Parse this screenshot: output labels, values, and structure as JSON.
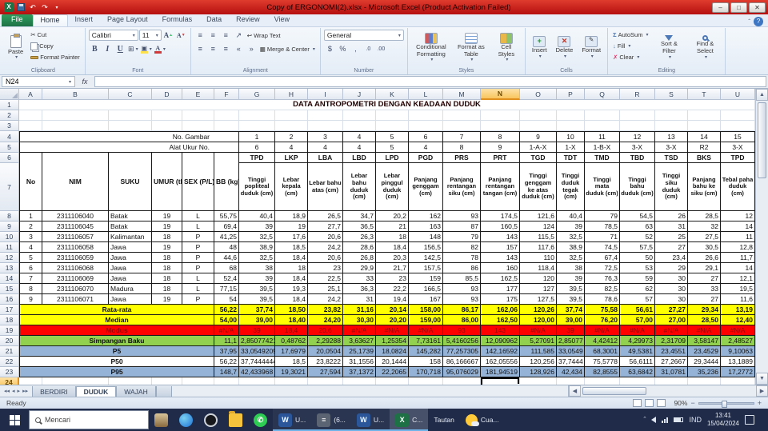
{
  "titlebar": {
    "title": "Copy of ERGONOMI(2).xlsx  -  Microsoft Excel (Product Activation Failed)"
  },
  "ribbon": {
    "file_tab": "File",
    "tabs": [
      "Home",
      "Insert",
      "Page Layout",
      "Formulas",
      "Data",
      "Review",
      "View"
    ],
    "active_tab": "Home",
    "clipboard": {
      "label": "Clipboard",
      "paste": "Paste",
      "cut": "Cut",
      "copy": "Copy",
      "format_painter": "Format Painter"
    },
    "font": {
      "label": "Font",
      "family": "Calibri",
      "size": "11",
      "bold": "B",
      "italic": "I",
      "underline": "U",
      "grow": "A",
      "shrink": "A"
    },
    "alignment": {
      "label": "Alignment",
      "wrap_text": "Wrap Text",
      "merge_center": "Merge & Center"
    },
    "number": {
      "label": "Number",
      "format": "General",
      "buttons": [
        "$",
        "%",
        ",",
        ".0",
        ".00"
      ]
    },
    "styles": {
      "label": "Styles",
      "conditional": "Conditional Formatting",
      "format_table": "Format as Table",
      "cell_styles": "Cell Styles"
    },
    "cells": {
      "label": "Cells",
      "insert": "Insert",
      "delete": "Delete",
      "format": "Format"
    },
    "editing": {
      "label": "Editing",
      "autosum": "AutoSum",
      "fill": "Fill",
      "clear": "Clear",
      "sort_filter": "Sort & Filter",
      "find_select": "Find & Select"
    }
  },
  "formula_bar": {
    "name_box": "N24",
    "fx": "fx",
    "content": ""
  },
  "sheet": {
    "selected_cell": "N24",
    "selected_col": "N",
    "selected_row": 24,
    "col_letters": [
      "A",
      "B",
      "C",
      "D",
      "E",
      "F",
      "G",
      "H",
      "I",
      "J",
      "K",
      "L",
      "M",
      "N",
      "O",
      "P",
      "Q",
      "R",
      "S",
      "T",
      "U"
    ],
    "title": "DATA ANTROPOMETRI DENGAN KEADAAN DUDUK",
    "gambar_label": "No. Gambar",
    "gambar_values": [
      "1",
      "2",
      "3",
      "4",
      "5",
      "6",
      "7",
      "8",
      "9",
      "10",
      "11",
      "12",
      "13",
      "14",
      "15"
    ],
    "alat_label": "Alat Ukur No.",
    "alat_values": [
      "6",
      "4",
      "4",
      "4",
      "5",
      "4",
      "8",
      "9",
      "1-A-X",
      "1-X",
      "1-B-X",
      "3-X",
      "3-X",
      "R2",
      "3-X"
    ],
    "left_headers": [
      "No",
      "NIM",
      "SUKU",
      "UMUR (th)",
      "SEX (P/L)",
      "BB (kg)"
    ],
    "codes": [
      "TPD",
      "LKP",
      "LBA",
      "LBD",
      "LPD",
      "PGD",
      "PRS",
      "PRT",
      "TGD",
      "TDT",
      "TMD",
      "TBD",
      "TSD",
      "BKS",
      "TPD"
    ],
    "measure_headers": [
      "Tinggi popliteal duduk (cm)",
      "Lebar kepala (cm)",
      "Lebar bahu atas (cm)",
      "Lebar bahu duduk (cm)",
      "Lebar pinggul duduk (cm)",
      "Panjang genggam (cm)",
      "Panjang rentangan siku (cm)",
      "Panjang rentangan tangan (cm)",
      "Tinggi genggam ke atas duduk (cm)",
      "Tinggi duduk tegak (cm)",
      "Tinggi mata duduk (cm)",
      "Tinggi bahu duduk (cm)",
      "Tinggi siku duduk (cm)",
      "Panjang bahu ke siku (cm)",
      "Tebal paha duduk (cm)"
    ],
    "data_rows": [
      [
        "1",
        "2311106040",
        "Batak",
        "19",
        "L",
        "55,75",
        "40,4",
        "18,9",
        "26,5",
        "34,7",
        "20,2",
        "162",
        "93",
        "174,5",
        "121,6",
        "40,4",
        "79",
        "54,5",
        "26",
        "28,5",
        "12"
      ],
      [
        "2",
        "2311106045",
        "Batak",
        "19",
        "L",
        "69,4",
        "39",
        "19",
        "27,7",
        "36,5",
        "21",
        "163",
        "87",
        "160,5",
        "124",
        "39",
        "78,5",
        "63",
        "31",
        "32",
        "14"
      ],
      [
        "3",
        "2311106057",
        "Kalimantan",
        "18",
        "P",
        "41,25",
        "32,5",
        "17,6",
        "20,6",
        "26,3",
        "18",
        "148",
        "79",
        "143",
        "115,5",
        "32,5",
        "71",
        "52",
        "25",
        "27,5",
        "11"
      ],
      [
        "4",
        "2311106058",
        "Jawa",
        "19",
        "P",
        "48",
        "38,9",
        "18,5",
        "24,2",
        "28,6",
        "18,4",
        "156,5",
        "82",
        "157",
        "117,6",
        "38,9",
        "74,5",
        "57,5",
        "27",
        "30,5",
        "12,8"
      ],
      [
        "5",
        "2311106059",
        "Jawa",
        "18",
        "P",
        "44,6",
        "32,5",
        "18,4",
        "20,6",
        "26,8",
        "20,3",
        "142,5",
        "78",
        "143",
        "110",
        "32,5",
        "67,4",
        "50",
        "23,4",
        "26,6",
        "11,7"
      ],
      [
        "6",
        "2311106068",
        "Jawa",
        "18",
        "P",
        "68",
        "38",
        "18",
        "23",
        "29,9",
        "21,7",
        "157,5",
        "86",
        "160",
        "118,4",
        "38",
        "72,5",
        "53",
        "29",
        "29,1",
        "14"
      ],
      [
        "7",
        "2311106069",
        "Jawa",
        "18",
        "L",
        "52,4",
        "39",
        "18,4",
        "22,5",
        "33",
        "23",
        "159",
        "85,5",
        "162,5",
        "120",
        "39",
        "76,3",
        "59",
        "30",
        "27",
        "12,1"
      ],
      [
        "8",
        "2311106070",
        "Madura",
        "18",
        "L",
        "77,15",
        "39,5",
        "19,3",
        "25,1",
        "36,3",
        "22,2",
        "166,5",
        "93",
        "177",
        "127",
        "39,5",
        "82,5",
        "62",
        "30",
        "33",
        "19,5"
      ],
      [
        "9",
        "2311106071",
        "Jawa",
        "19",
        "P",
        "54",
        "39,5",
        "18,4",
        "24,2",
        "31",
        "19,4",
        "167",
        "93",
        "175",
        "127,5",
        "39,5",
        "78,6",
        "57",
        "30",
        "27",
        "11,6"
      ]
    ],
    "stat_rows": [
      {
        "label": "Rata-rata",
        "style": "yellow",
        "bold": true,
        "values": [
          "56,22",
          "37,74",
          "18,50",
          "23,82",
          "31,16",
          "20,14",
          "158,00",
          "86,17",
          "162,06",
          "120,26",
          "37,74",
          "75,58",
          "56,61",
          "27,27",
          "29,34",
          "13,19"
        ]
      },
      {
        "label": "Median",
        "style": "yellow",
        "bold": true,
        "values": [
          "54,00",
          "39,00",
          "18,40",
          "24,20",
          "30,30",
          "20,20",
          "159,00",
          "86,00",
          "162,50",
          "120,00",
          "39,00",
          "76,20",
          "57,00",
          "27,00",
          "28,50",
          "12,40"
        ]
      },
      {
        "label": "Modus",
        "style": "red",
        "bold": false,
        "values": [
          "#N/A",
          "39",
          "18,4",
          "20,6",
          "#N/A",
          "#N/A",
          "#N/A",
          "93",
          "143",
          "#N/A",
          "39",
          "#N/A",
          "#N/A",
          "#N/A",
          "#N/A",
          "#N/A"
        ]
      },
      {
        "label": "Simpangan Baku",
        "style": "green",
        "bold": false,
        "values": [
          "11,1",
          "2,85077421",
          "0,48762",
          "2,29288",
          "3,63627",
          "1,25354",
          "7,73161",
          "5,4160256",
          "12,090962",
          "5,27091",
          "2,85077",
          "4,42412",
          "4,29973",
          "2,31709",
          "3,58147",
          "2,48527"
        ]
      },
      {
        "label": "P5",
        "style": "blue",
        "bold": false,
        "values": [
          "37,95",
          "33,0549209",
          "17,6979",
          "20,0504",
          "25,1739",
          "18,0824",
          "145,282",
          "77,257305",
          "142,16592",
          "111,585",
          "33,0549",
          "68,3001",
          "49,5381",
          "23,4551",
          "23,4529",
          "9,10063"
        ]
      },
      {
        "label": "P50",
        "style": "white",
        "bold": false,
        "values": [
          "56,22",
          "37,7444444",
          "18,5",
          "23,8222",
          "31,1556",
          "20,1444",
          "158",
          "86,166667",
          "162,05556",
          "120,256",
          "37,7444",
          "75,5778",
          "56,6111",
          "27,2667",
          "29,3444",
          "13,1889"
        ]
      },
      {
        "label": "P95",
        "style": "blue",
        "bold": false,
        "values": [
          "148,7",
          "42,433968",
          "19,3021",
          "27,594",
          "37,1372",
          "22,2065",
          "170,718",
          "95,076029",
          "181,94519",
          "128,926",
          "42,434",
          "82,8555",
          "63,6842",
          "31,0781",
          "35,236",
          "17,2772"
        ]
      }
    ]
  },
  "tab_strip": {
    "tabs": [
      "BERDIRI",
      "DUDUK",
      "WAJAH"
    ],
    "active": "DUDUK"
  },
  "status_bar": {
    "mode": "Ready",
    "zoom": "90%"
  },
  "taskbar": {
    "search_placeholder": "Mencari",
    "apps": [
      {
        "name": "photos",
        "label": "",
        "open": false,
        "active": false
      },
      {
        "name": "edge",
        "label": "",
        "open": false,
        "active": false
      },
      {
        "name": "obs",
        "label": "",
        "open": false,
        "active": false
      },
      {
        "name": "file-explorer",
        "label": "",
        "open": false,
        "active": false
      },
      {
        "name": "whatsapp",
        "label": "",
        "open": false,
        "active": false
      },
      {
        "name": "word-window",
        "label": "U...",
        "open": true,
        "active": false
      },
      {
        "name": "window-group",
        "label": "(6...",
        "open": true,
        "active": false
      },
      {
        "name": "word-window-2",
        "label": "U...",
        "open": true,
        "active": false
      },
      {
        "name": "excel-window",
        "label": "C...",
        "open": true,
        "active": true
      },
      {
        "name": "links",
        "label": "Tautan",
        "open": false,
        "active": false
      },
      {
        "name": "weather",
        "label": "Cua...",
        "open": false,
        "active": false
      }
    ],
    "tray": {
      "language": "IND",
      "time": "13:41",
      "date": "15/04/2024"
    }
  }
}
